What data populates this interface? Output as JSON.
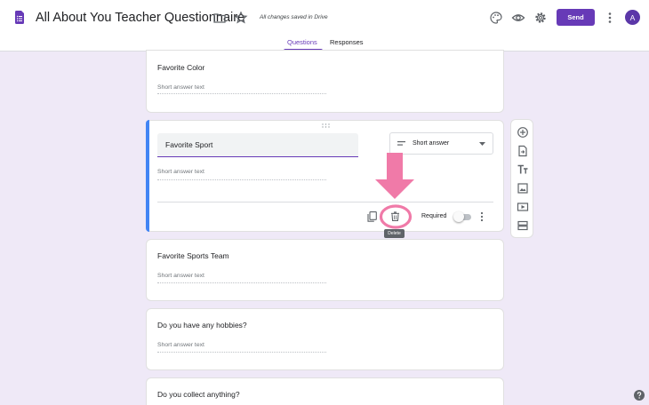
{
  "header": {
    "title": "All About You Teacher Questionnaire",
    "save_status": "All changes saved in Drive",
    "send_label": "Send",
    "avatar_initial": "A",
    "icons": [
      "forms-doc-icon",
      "folder-icon",
      "star-icon",
      "palette-icon",
      "preview-eye-icon",
      "settings-gear-icon",
      "more-vert-icon"
    ]
  },
  "tabs": [
    {
      "label": "Questions",
      "active": true
    },
    {
      "label": "Responses",
      "active": false
    }
  ],
  "questions": [
    {
      "title": "Favorite Color",
      "placeholder": "Short answer text"
    },
    {
      "title": "Favorite Sport",
      "placeholder": "Short answer text",
      "type": "Short answer",
      "active": true,
      "required_label": "Required",
      "required": false
    },
    {
      "title": "Favorite Sports Team",
      "placeholder": "Short answer text"
    },
    {
      "title": "Do you have any hobbies?",
      "placeholder": "Short answer text"
    },
    {
      "title": "Do you collect anything?"
    }
  ],
  "tooltip": {
    "label": "Delete"
  },
  "side_toolbar": [
    "add-question-icon",
    "import-questions-icon",
    "add-title-icon",
    "add-image-icon",
    "add-video-icon",
    "add-section-icon"
  ],
  "colors": {
    "accent": "#673ab7",
    "active_bar": "#4285f4",
    "background": "#efe9f7",
    "highlight": "#f07aa8"
  }
}
